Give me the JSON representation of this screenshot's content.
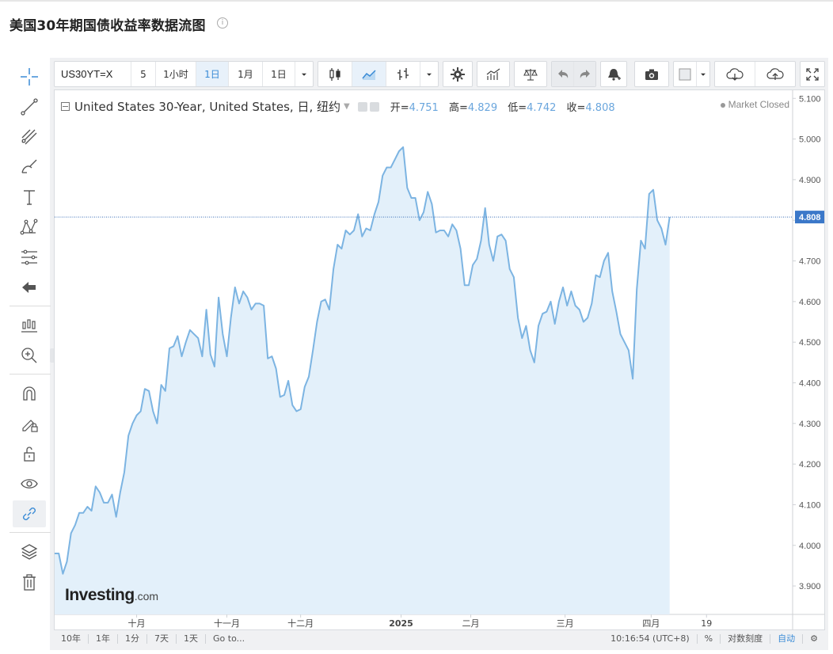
{
  "page": {
    "title": "美国30年期国债收益率数据流图",
    "info_icon": "ⓘ"
  },
  "toolbar": {
    "symbol": "US30YT=X",
    "interval_input": "5",
    "intervals": [
      "1小时",
      "1日",
      "1月",
      "1日"
    ],
    "active_interval": "1日",
    "icons": [
      "candlestick-icon",
      "area-chart-icon",
      "bar-chart-icon",
      "settings-icon",
      "indicators-icon",
      "compare-icon",
      "undo-icon",
      "redo-icon",
      "alert-icon",
      "camera-icon",
      "color-icon",
      "cloud-download-icon",
      "cloud-upload-icon",
      "fullscreen-icon"
    ]
  },
  "left_toolbar": {
    "icons": [
      "crosshair-icon",
      "trend-line-icon",
      "fork-icon",
      "brush-icon",
      "text-icon",
      "pattern-icon",
      "fib-icon",
      "back-arrow-icon",
      "measure-icon",
      "zoom-in-icon",
      "magnet-icon",
      "lock-drawing-icon",
      "unlock-icon",
      "eye-icon",
      "link-icon",
      "layers-icon",
      "trash-icon"
    ]
  },
  "legend": {
    "symbol_name": "United States 30-Year, United States, 日, 纽约",
    "open_label": "开=",
    "open": "4.751",
    "high_label": "高=",
    "high": "4.829",
    "low_label": "低=",
    "low": "4.742",
    "close_label": "收=",
    "close": "4.808"
  },
  "market_status": "Market Closed",
  "watermark": {
    "brand": "Investing",
    "suffix": ".com"
  },
  "colors": {
    "line": "#7cb4e2",
    "area_fill": "#e3f0fa",
    "accent": "#3a8bd6",
    "price_label_bg": "#3b78c9"
  },
  "chart_data": {
    "type": "area",
    "y_axis_ticks": [
      "5.100",
      "5.000",
      "4.900",
      "4.800",
      "4.700",
      "4.600",
      "4.500",
      "4.400",
      "4.300",
      "4.200",
      "4.100",
      "4.000",
      "3.900"
    ],
    "ylim": [
      3.83,
      5.12
    ],
    "x_axis_labels": [
      "十月",
      "十一月",
      "十二月",
      "2025",
      "二月",
      "三月",
      "四月",
      "19"
    ],
    "x_label_positions": [
      20,
      42,
      60,
      84.5,
      101.5,
      124.5,
      145.5,
      159
    ],
    "current_value": "4.808",
    "current_value_num": 4.808,
    "x": [
      0,
      1,
      2,
      3,
      4,
      5,
      6,
      7,
      8,
      9,
      10,
      11,
      12,
      13,
      14,
      15,
      16,
      17,
      18,
      19,
      20,
      21,
      22,
      23,
      24,
      25,
      26,
      27,
      28,
      29,
      30,
      31,
      32,
      33,
      34,
      35,
      36,
      37,
      38,
      39,
      40,
      41,
      42,
      43,
      44,
      45,
      46,
      47,
      48,
      49,
      50,
      51,
      52,
      53,
      54,
      55,
      56,
      57,
      58,
      59,
      60,
      61,
      62,
      63,
      64,
      65,
      66,
      67,
      68,
      69,
      70,
      71,
      72,
      73,
      74,
      75,
      76,
      77,
      78,
      79,
      80,
      81,
      82,
      83,
      84,
      85,
      86,
      87,
      88,
      89,
      90,
      91,
      92,
      93,
      94,
      95,
      96,
      97,
      98,
      99,
      100,
      101,
      102,
      103,
      104,
      105,
      106,
      107,
      108,
      109,
      110,
      111,
      112,
      113,
      114,
      115,
      116,
      117,
      118,
      119,
      120,
      121,
      122,
      123,
      124,
      125,
      126,
      127,
      128,
      129,
      130,
      131,
      132,
      133,
      134,
      135,
      136,
      137,
      138,
      139,
      140,
      141,
      142,
      143,
      144,
      145,
      146,
      147,
      148,
      149,
      150,
      151,
      152,
      153,
      154,
      155,
      156,
      157,
      158,
      159,
      160
    ],
    "values": [
      3.98,
      3.98,
      3.93,
      3.96,
      4.03,
      4.05,
      4.08,
      4.08,
      4.095,
      4.085,
      4.145,
      4.13,
      4.105,
      4.105,
      4.125,
      4.07,
      4.13,
      4.18,
      4.27,
      4.3,
      4.32,
      4.33,
      4.385,
      4.38,
      4.33,
      4.3,
      4.395,
      4.38,
      4.485,
      4.49,
      4.515,
      4.465,
      4.5,
      4.53,
      4.52,
      4.51,
      4.465,
      4.58,
      4.47,
      4.44,
      4.61,
      4.52,
      4.465,
      4.56,
      4.635,
      4.595,
      4.625,
      4.61,
      4.58,
      4.595,
      4.595,
      4.59,
      4.46,
      4.465,
      4.435,
      4.365,
      4.37,
      4.405,
      4.345,
      4.33,
      4.335,
      4.39,
      4.415,
      4.48,
      4.55,
      4.6,
      4.605,
      4.58,
      4.68,
      4.74,
      4.73,
      4.775,
      4.765,
      4.775,
      4.815,
      4.76,
      4.78,
      4.775,
      4.815,
      4.845,
      4.91,
      4.93,
      4.93,
      4.95,
      4.97,
      4.98,
      4.88,
      4.855,
      4.855,
      4.8,
      4.82,
      4.87,
      4.84,
      4.77,
      4.775,
      4.775,
      4.76,
      4.79,
      4.775,
      4.73,
      4.64,
      4.64,
      4.69,
      4.705,
      4.75,
      4.83,
      4.74,
      4.7,
      4.76,
      4.765,
      4.75,
      4.68,
      4.66,
      4.56,
      4.51,
      4.54,
      4.48,
      4.45,
      4.54,
      4.57,
      4.575,
      4.6,
      4.545,
      4.6,
      4.635,
      4.59,
      4.625,
      4.59,
      4.58,
      4.55,
      4.56,
      4.595,
      4.665,
      4.66,
      4.7,
      4.72,
      4.625,
      4.575,
      4.52,
      4.5,
      4.48,
      4.41,
      4.63,
      4.75,
      4.73,
      4.865,
      4.875,
      4.8,
      4.78,
      4.74,
      4.808
    ]
  },
  "bottom_bar": {
    "ranges": [
      "10年",
      "1年",
      "1分",
      "7天",
      "1天",
      "Go to..."
    ],
    "time": "10:16:54 (UTC+8)",
    "percent": "%",
    "log_scale": "对数刻度",
    "auto": "自动"
  }
}
